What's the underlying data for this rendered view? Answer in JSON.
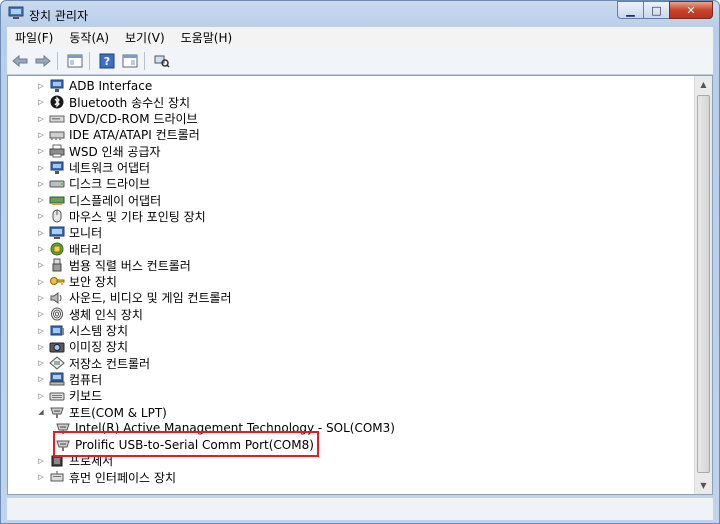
{
  "window": {
    "title": "장치 관리자"
  },
  "menu": [
    "파일(F)",
    "동작(A)",
    "보기(V)",
    "도움말(H)"
  ],
  "toolbar": {
    "back_icon": "back-arrow-icon",
    "forward_icon": "forward-arrow-icon"
  },
  "tree": [
    {
      "label": "ADB Interface",
      "icon": "adb-icon",
      "level": 1,
      "expander": "collapsed"
    },
    {
      "label": "Bluetooth 송수신 장치",
      "icon": "bluetooth-icon",
      "level": 1,
      "expander": "collapsed"
    },
    {
      "label": "DVD/CD-ROM 드라이브",
      "icon": "disc-drive-icon",
      "level": 1,
      "expander": "collapsed"
    },
    {
      "label": "IDE ATA/ATAPI 컨트롤러",
      "icon": "ide-controller-icon",
      "level": 1,
      "expander": "collapsed"
    },
    {
      "label": "WSD 인쇄 공급자",
      "icon": "printer-icon",
      "level": 1,
      "expander": "collapsed"
    },
    {
      "label": "네트워크 어댑터",
      "icon": "network-adapter-icon",
      "level": 1,
      "expander": "collapsed"
    },
    {
      "label": "디스크 드라이브",
      "icon": "disk-drive-icon",
      "level": 1,
      "expander": "collapsed"
    },
    {
      "label": "디스플레이 어댑터",
      "icon": "display-adapter-icon",
      "level": 1,
      "expander": "collapsed"
    },
    {
      "label": "마우스 및 기타 포인팅 장치",
      "icon": "mouse-icon",
      "level": 1,
      "expander": "collapsed"
    },
    {
      "label": "모니터",
      "icon": "monitor-icon",
      "level": 1,
      "expander": "collapsed"
    },
    {
      "label": "배터리",
      "icon": "battery-icon",
      "level": 1,
      "expander": "collapsed"
    },
    {
      "label": "범용 직렬 버스 컨트롤러",
      "icon": "usb-icon",
      "level": 1,
      "expander": "collapsed"
    },
    {
      "label": "보안 장치",
      "icon": "key-icon",
      "level": 1,
      "expander": "collapsed"
    },
    {
      "label": "사운드, 비디오 및 게임 컨트롤러",
      "icon": "speaker-icon",
      "level": 1,
      "expander": "collapsed"
    },
    {
      "label": "생체 인식 장치",
      "icon": "fingerprint-icon",
      "level": 1,
      "expander": "collapsed"
    },
    {
      "label": "시스템 장치",
      "icon": "system-device-icon",
      "level": 1,
      "expander": "collapsed"
    },
    {
      "label": "이미징 장치",
      "icon": "camera-icon",
      "level": 1,
      "expander": "collapsed"
    },
    {
      "label": "저장소 컨트롤러",
      "icon": "storage-controller-icon",
      "level": 1,
      "expander": "collapsed"
    },
    {
      "label": "컴퓨터",
      "icon": "computer-icon",
      "level": 1,
      "expander": "collapsed"
    },
    {
      "label": "키보드",
      "icon": "keyboard-icon",
      "level": 1,
      "expander": "collapsed"
    },
    {
      "label": "포트(COM & LPT)",
      "icon": "port-icon",
      "level": 1,
      "expander": "expanded"
    },
    {
      "label": "Intel(R) Active Management Technology - SOL(COM3)",
      "icon": "port-icon",
      "level": 2,
      "expander": "none"
    },
    {
      "label": "Prolific USB-to-Serial Comm Port(COM8)",
      "icon": "port-icon",
      "level": 2,
      "expander": "none"
    },
    {
      "label": "프로세서",
      "icon": "processor-icon",
      "level": 1,
      "expander": "collapsed"
    },
    {
      "label": "휴먼 인터페이스 장치",
      "icon": "hid-icon",
      "level": 1,
      "expander": "collapsed"
    }
  ],
  "colors": {
    "highlight_border": "#e02020"
  }
}
